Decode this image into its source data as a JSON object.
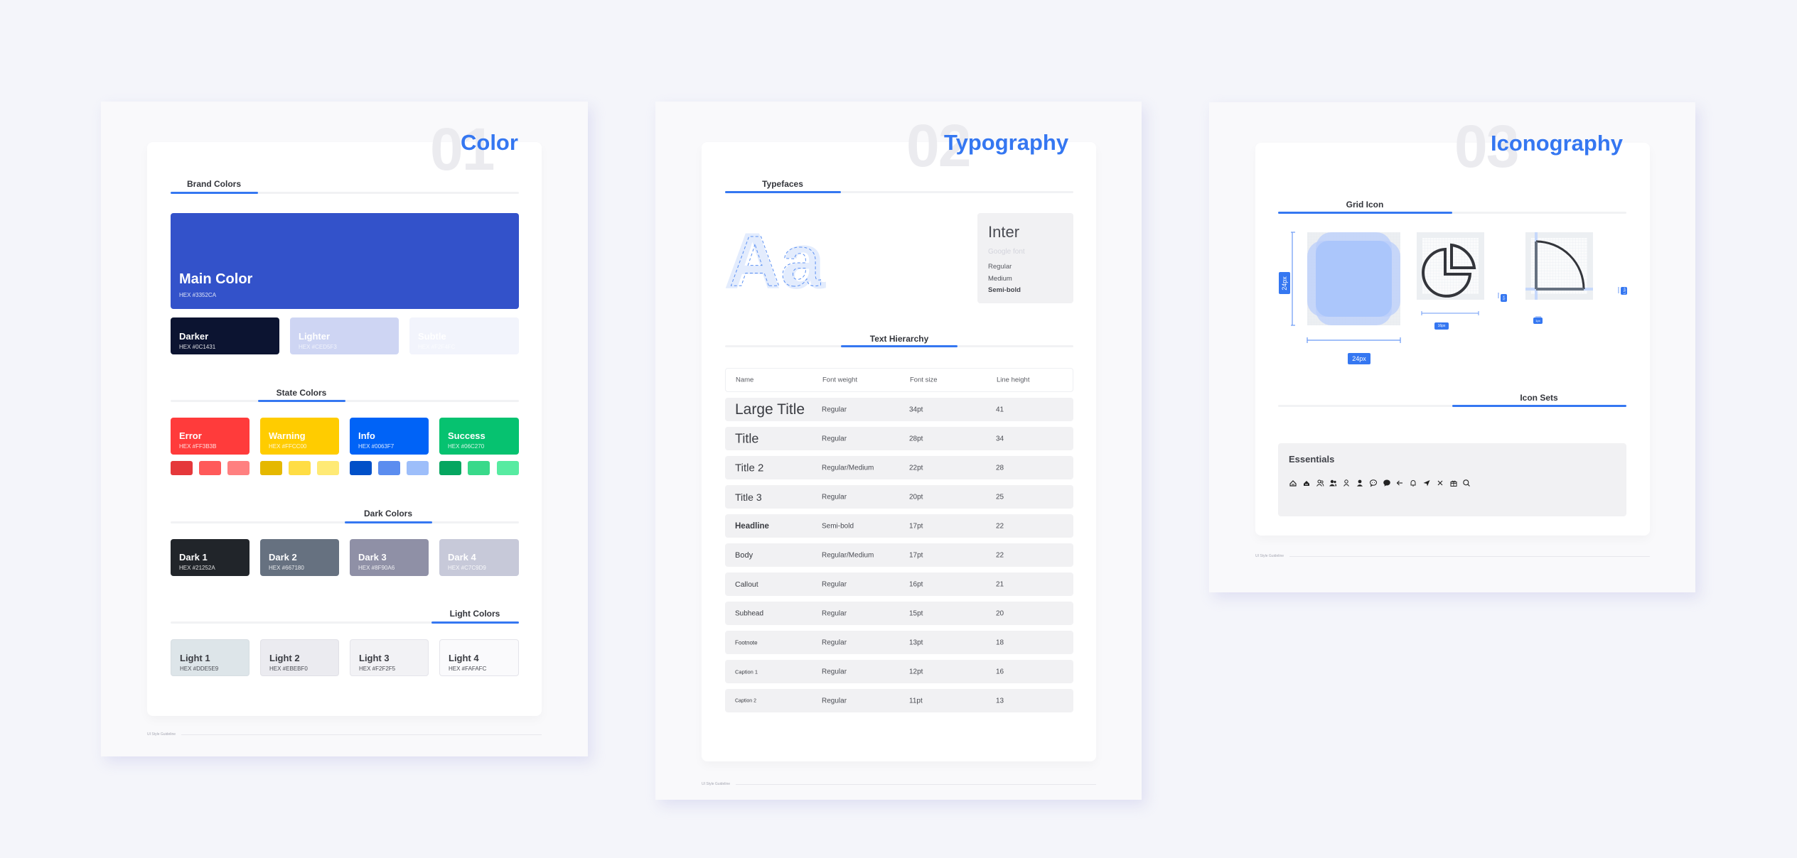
{
  "pages": {
    "color": {
      "number": "01",
      "title": "Color",
      "footer": "UI Style Guideline",
      "brand": {
        "heading": "Brand Colors",
        "main": {
          "name": "Main Color",
          "hex": "HEX #3352CA",
          "color": "#3352CA"
        },
        "variants": [
          {
            "name": "Darker",
            "hex": "HEX #0C1431",
            "color": "#0C1431"
          },
          {
            "name": "Lighter",
            "hex": "HEX #CED5F3",
            "color": "#CED5F3"
          },
          {
            "name": "Subtle",
            "hex": "HEX #F2F4FC",
            "color": "#F2F4FC"
          }
        ]
      },
      "state": {
        "heading": "State Colors",
        "items": [
          {
            "name": "Error",
            "hex": "HEX #FF3B3B",
            "color": "#FF3B3B",
            "shades": [
              "#E5383B",
              "#FF5A5A",
              "#FF8080"
            ]
          },
          {
            "name": "Warning",
            "hex": "HEX #FFCC00",
            "color": "#FFCC00",
            "shades": [
              "#E5B800",
              "#FFDD44",
              "#FFEA75"
            ]
          },
          {
            "name": "Info",
            "hex": "HEX #0063F7",
            "color": "#0063F7",
            "shades": [
              "#0050C8",
              "#5B8DEF",
              "#9DBEFA"
            ]
          },
          {
            "name": "Success",
            "hex": "HEX #06C270",
            "color": "#06C270",
            "shades": [
              "#05A660",
              "#39D98A",
              "#57EBA1"
            ]
          }
        ]
      },
      "dark": {
        "heading": "Dark Colors",
        "items": [
          {
            "name": "Dark 1",
            "hex": "HEX #21252A",
            "color": "#21252A"
          },
          {
            "name": "Dark 2",
            "hex": "HEX #667180",
            "color": "#667180"
          },
          {
            "name": "Dark 3",
            "hex": "HEX #8F90A6",
            "color": "#8F90A6"
          },
          {
            "name": "Dark 4",
            "hex": "HEX #C7C9D9",
            "color": "#C7C9D9"
          }
        ]
      },
      "light": {
        "heading": "Light Colors",
        "items": [
          {
            "name": "Light 1",
            "hex": "HEX #DDE5E9",
            "color": "#DDE5E9"
          },
          {
            "name": "Light 2",
            "hex": "HEX #EBEBF0",
            "color": "#EBEBF0"
          },
          {
            "name": "Light 3",
            "hex": "HEX #F2F2F5",
            "color": "#F2F2F5"
          },
          {
            "name": "Light 4",
            "hex": "HEX #FAFAFC",
            "color": "#FAFAFC"
          }
        ]
      }
    },
    "typography": {
      "number": "02",
      "title": "Typography",
      "footer": "UI Style Guideline",
      "typefaces": {
        "heading": "Typefaces",
        "sample": "Aa",
        "font_name": "Inter",
        "font_source": "Google font",
        "weights": [
          "Regular",
          "Medium",
          "Semi-bold"
        ]
      },
      "hierarchy": {
        "heading": "Text Hierarchy",
        "columns": [
          "Name",
          "Font weight",
          "Font size",
          "Line height"
        ],
        "rows": [
          {
            "name": "Large Title",
            "weight": "Regular",
            "size": "34pt",
            "line": "41"
          },
          {
            "name": "Title",
            "weight": "Regular",
            "size": "28pt",
            "line": "34"
          },
          {
            "name": "Title 2",
            "weight": "Regular/Medium",
            "size": "22pt",
            "line": "28"
          },
          {
            "name": "Title 3",
            "weight": "Regular",
            "size": "20pt",
            "line": "25"
          },
          {
            "name": "Headline",
            "weight": "Semi-bold",
            "size": "17pt",
            "line": "22"
          },
          {
            "name": "Body",
            "weight": "Regular/Medium",
            "size": "17pt",
            "line": "22"
          },
          {
            "name": "Callout",
            "weight": "Regular",
            "size": "16pt",
            "line": "21"
          },
          {
            "name": "Subhead",
            "weight": "Regular",
            "size": "15pt",
            "line": "20"
          },
          {
            "name": "Footnote",
            "weight": "Regular",
            "size": "13pt",
            "line": "18"
          },
          {
            "name": "Caption 1",
            "weight": "Regular",
            "size": "12pt",
            "line": "16"
          },
          {
            "name": "Caption 2",
            "weight": "Regular",
            "size": "11pt",
            "line": "13"
          }
        ]
      }
    },
    "iconography": {
      "number": "03",
      "title": "Iconography",
      "footer": "UI Style Guideline",
      "grid": {
        "heading": "Grid Icon",
        "height_label": "24px",
        "width_label": "24px",
        "inner_label": "16px",
        "padding_label": "2px",
        "stroke_label": "1px",
        "stroke_label_2": "1.5px"
      },
      "sets": {
        "heading": "Icon Sets",
        "group": "Essentials",
        "icons": [
          "home-outline-icon",
          "home-filled-icon",
          "users-outline-icon",
          "users-filled-icon",
          "user-outline-icon",
          "user-filled-icon",
          "chat-outline-icon",
          "chat-filled-icon",
          "arrow-left-icon",
          "bell-icon",
          "send-icon",
          "close-icon",
          "gift-icon",
          "search-icon"
        ]
      }
    }
  }
}
